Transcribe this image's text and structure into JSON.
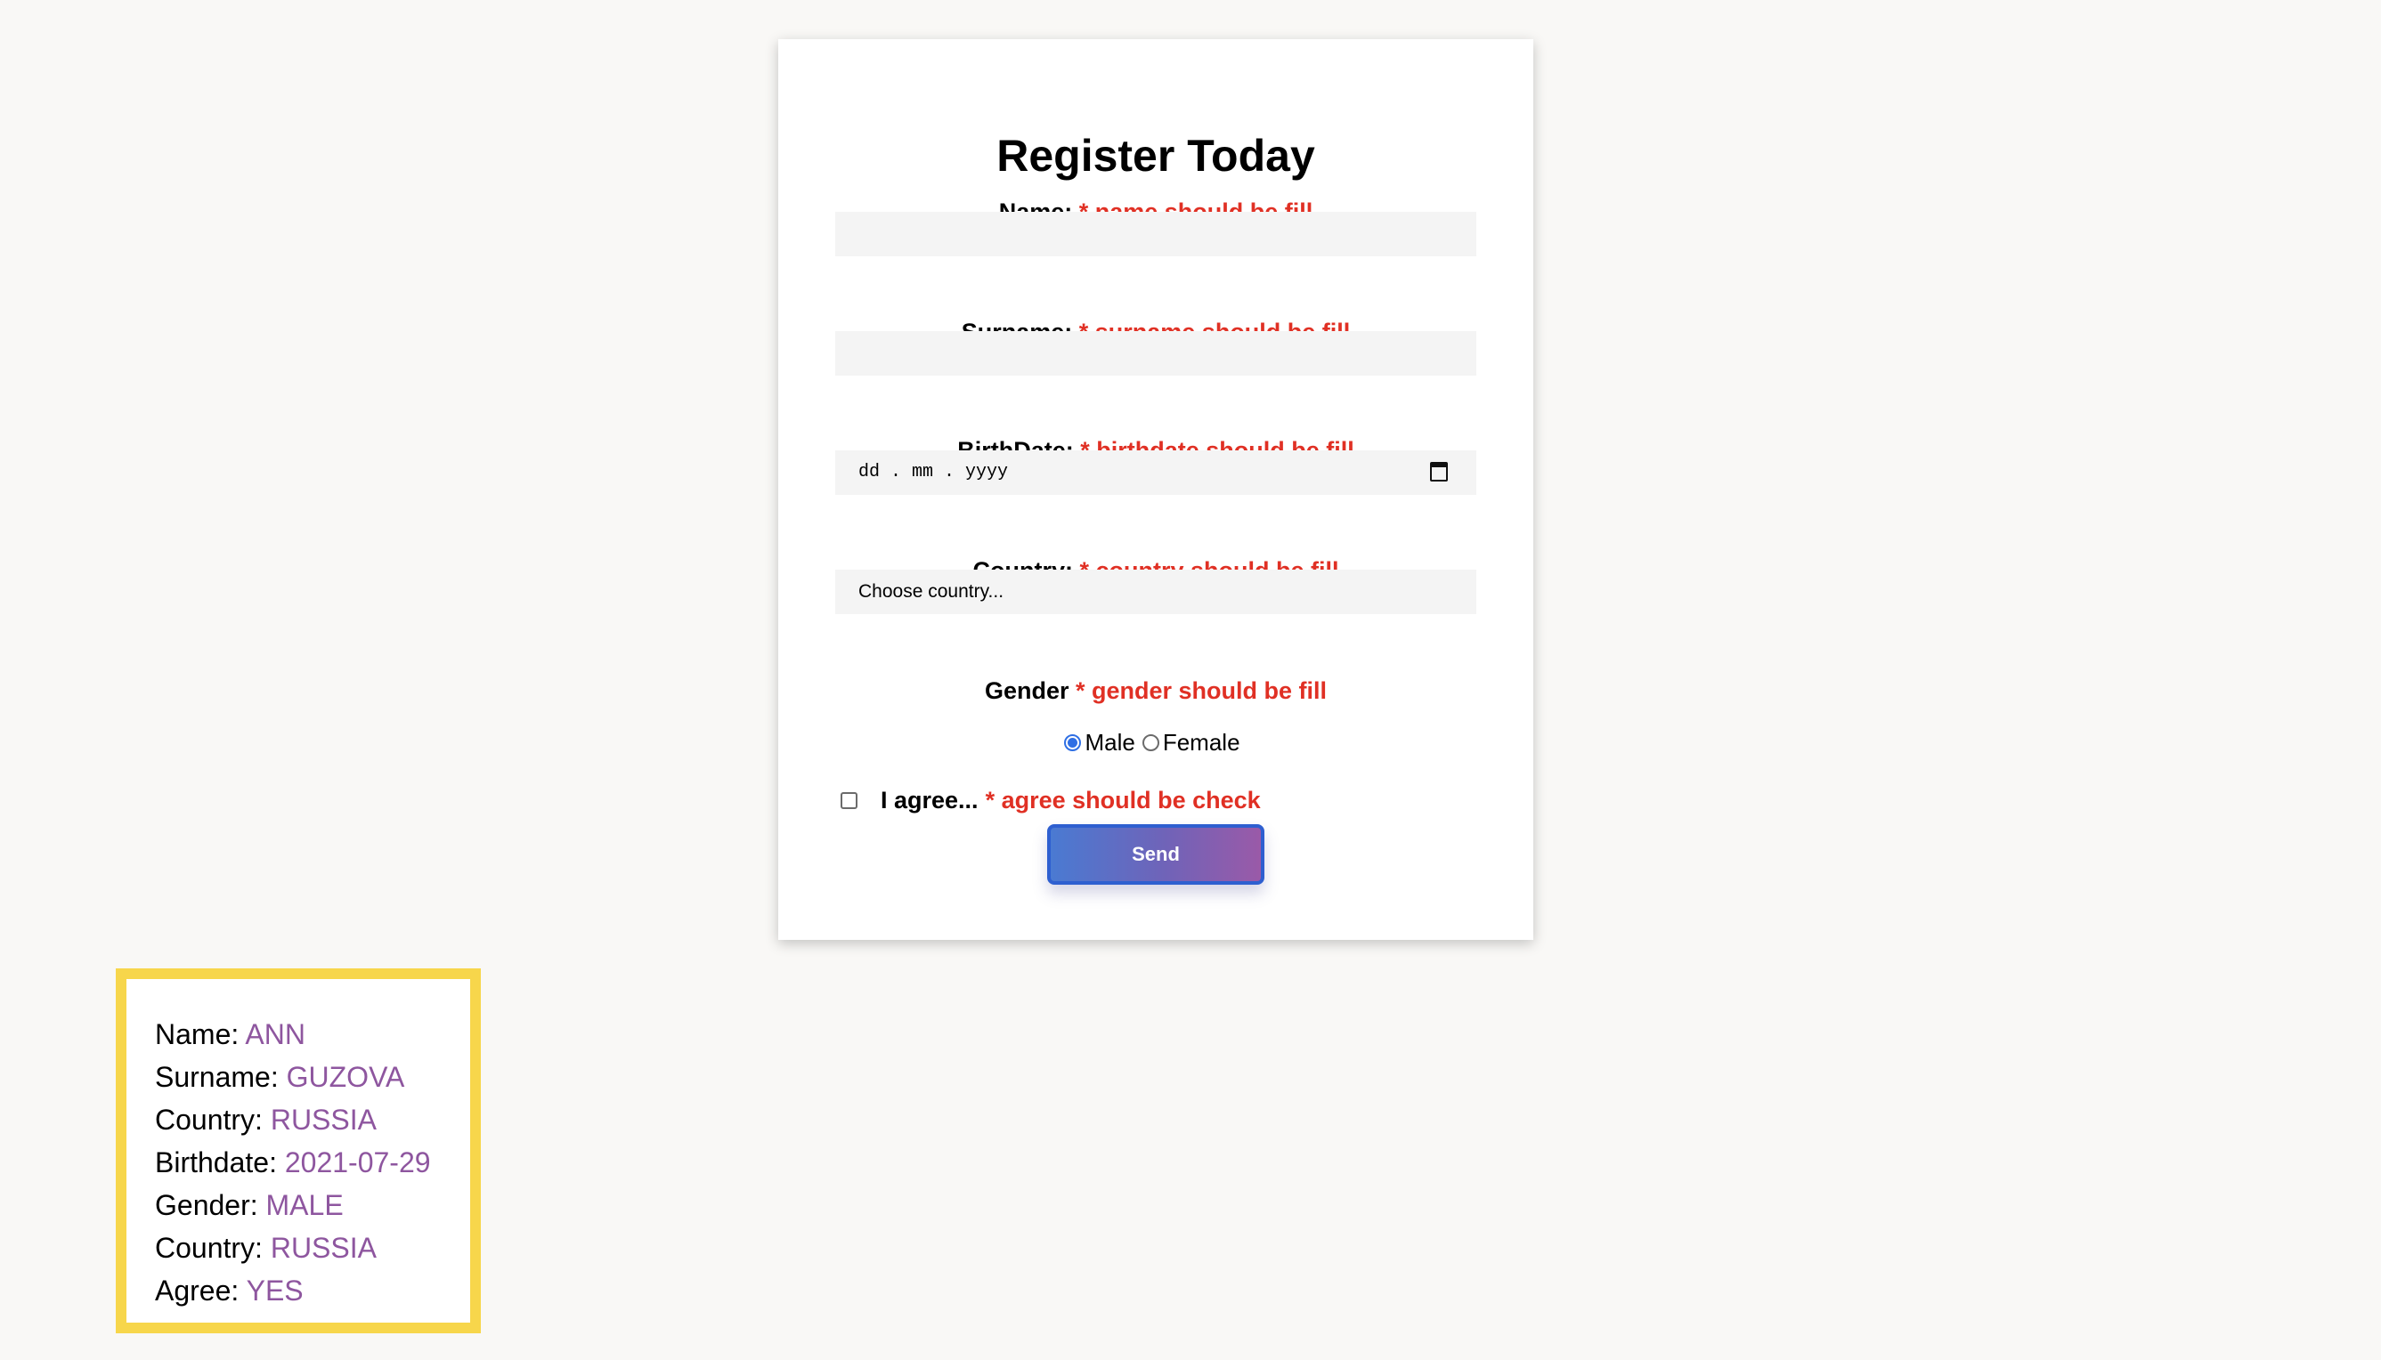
{
  "form": {
    "title": "Register Today",
    "name": {
      "label": "Name:",
      "error": "* name should be fill",
      "value": ""
    },
    "surname": {
      "label": "Surname:",
      "error": "* surname should be fill",
      "value": ""
    },
    "birthdate": {
      "label": "BirthDate:",
      "error": "* birthdate should be fill",
      "placeholder": "dd . mm . yyyy",
      "icon": "calendar-icon"
    },
    "country": {
      "label": "Country:",
      "error": "* country should be fill",
      "selected": "Choose country..."
    },
    "gender": {
      "label": "Gender",
      "error": "* gender should be fill",
      "options": [
        {
          "label": "Male",
          "checked": true
        },
        {
          "label": "Female",
          "checked": false
        }
      ]
    },
    "agree": {
      "label": "I agree...",
      "error": "* agree should be check",
      "checked": false
    },
    "send_label": "Send",
    "colors": {
      "error": "#e03024",
      "button_gradient_start": "#4a7ad2",
      "button_gradient_end": "#9a5aa8",
      "button_border": "#2e5fd0"
    }
  },
  "result": {
    "border_color": "#f7d64b",
    "value_color": "#8e569f",
    "rows": [
      {
        "label": "Name:",
        "value": "ANN"
      },
      {
        "label": "Surname:",
        "value": "GUZOVA"
      },
      {
        "label": "Country:",
        "value": "RUSSIA"
      },
      {
        "label": "Birthdate:",
        "value": "2021-07-29"
      },
      {
        "label": "Gender:",
        "value": "MALE"
      },
      {
        "label": "Country:",
        "value": "RUSSIA"
      },
      {
        "label": "Agree:",
        "value": "YES"
      }
    ]
  }
}
